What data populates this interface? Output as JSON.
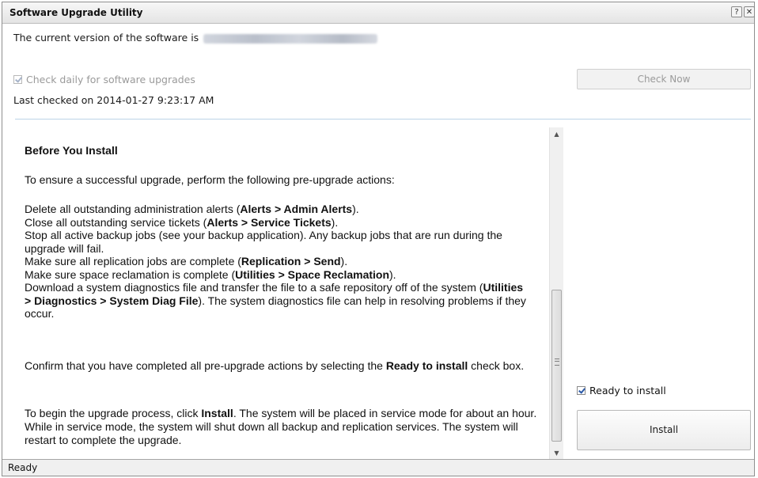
{
  "window": {
    "title": "Software Upgrade Utility",
    "help_glyph": "?",
    "close_glyph": "✕"
  },
  "version": {
    "text": "The current version of the software is"
  },
  "auto_check": {
    "label": "Check daily for software upgrades",
    "checked": true,
    "enabled": false
  },
  "last_checked": "Last checked on 2014-01-27 9:23:17 AM",
  "buttons": {
    "check_now": "Check Now",
    "install": "Install"
  },
  "content": {
    "heading": "Before You Install",
    "intro": "To ensure a successful upgrade, perform the following pre-upgrade actions:",
    "items": [
      {
        "pre": "Delete all outstanding administration alerts (",
        "bold": "Alerts > Admin Alerts",
        "post": ")."
      },
      {
        "pre": "Close all outstanding service tickets (",
        "bold": "Alerts > Service Tickets",
        "post": ")."
      },
      {
        "pre": "Stop all active backup jobs (see your backup application). Any backup jobs that are run during the upgrade will fail.",
        "bold": "",
        "post": ""
      },
      {
        "pre": "Make sure all replication jobs are complete (",
        "bold": "Replication > Send",
        "post": ")."
      },
      {
        "pre": "Make sure space reclamation is complete (",
        "bold": "Utilities > Space Reclamation",
        "post": ")."
      },
      {
        "pre": "Download a system diagnostics file and transfer the file to a safe repository off of the system (",
        "bold": "Utilities > Diagnostics > System Diag File",
        "post": "). The system diagnostics file can help in resolving problems if they occur."
      }
    ],
    "confirm_pre": "Confirm that you have completed all pre-upgrade actions by selecting the",
    "confirm_bold": "Ready to install",
    "confirm_post": "check box.",
    "begin_pre": "To begin the upgrade process, click",
    "begin_bold": "Install",
    "begin_post": ". The system will be placed in service mode for about an hour. While in service mode, the system will shut down all backup and replication services. The system will restart to complete the upgrade."
  },
  "ready_to_install": {
    "label": "Ready to install",
    "checked": true
  },
  "status": {
    "text": "Ready"
  },
  "scrollbar": {
    "up_glyph": "▲",
    "down_glyph": "▼"
  }
}
